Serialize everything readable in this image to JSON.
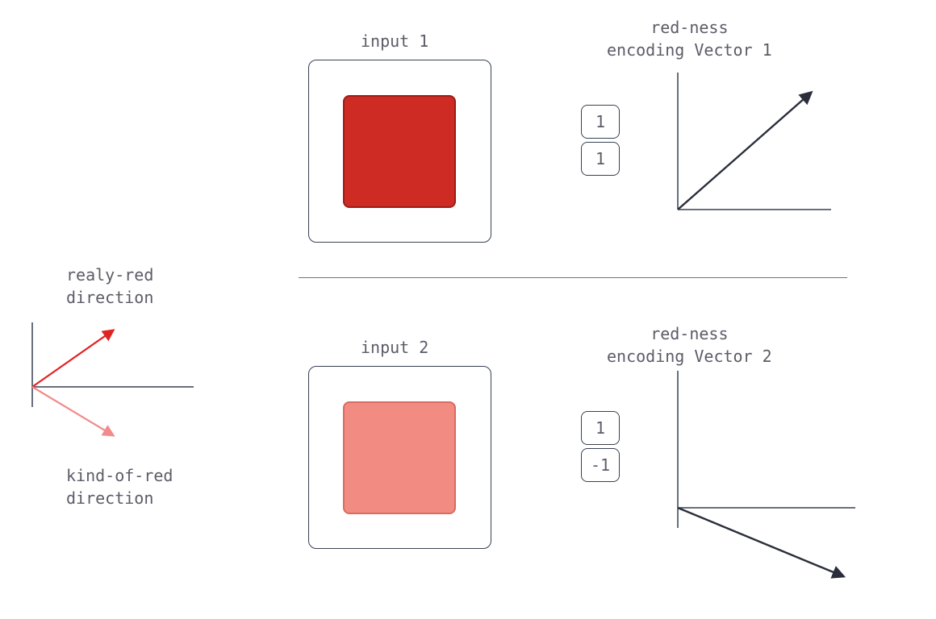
{
  "left": {
    "labels": {
      "really_red": "realy-red\ndirection",
      "kind_of_red": "kind-of-red\ndirection"
    },
    "colors": {
      "really_red": "#e02424",
      "kind_of_red": "#f28b8b",
      "axis": "#374151"
    }
  },
  "examples": [
    {
      "input_label": "input 1",
      "vector_label": "red-ness\nencoding Vector 1",
      "square_fill": "#cf2b25",
      "square_stroke": "#9f1c17",
      "vector": [
        "1",
        "1"
      ],
      "arrow_dir": "up-right"
    },
    {
      "input_label": "input 2",
      "vector_label": "red-ness\nencoding Vector 2",
      "square_fill": "#f28b82",
      "square_stroke": "#d96b63",
      "vector": [
        "1",
        "-1"
      ],
      "arrow_dir": "down-right"
    }
  ],
  "plot": {
    "axis_color": "#374151",
    "arrow_color": "#2a2e3a"
  }
}
